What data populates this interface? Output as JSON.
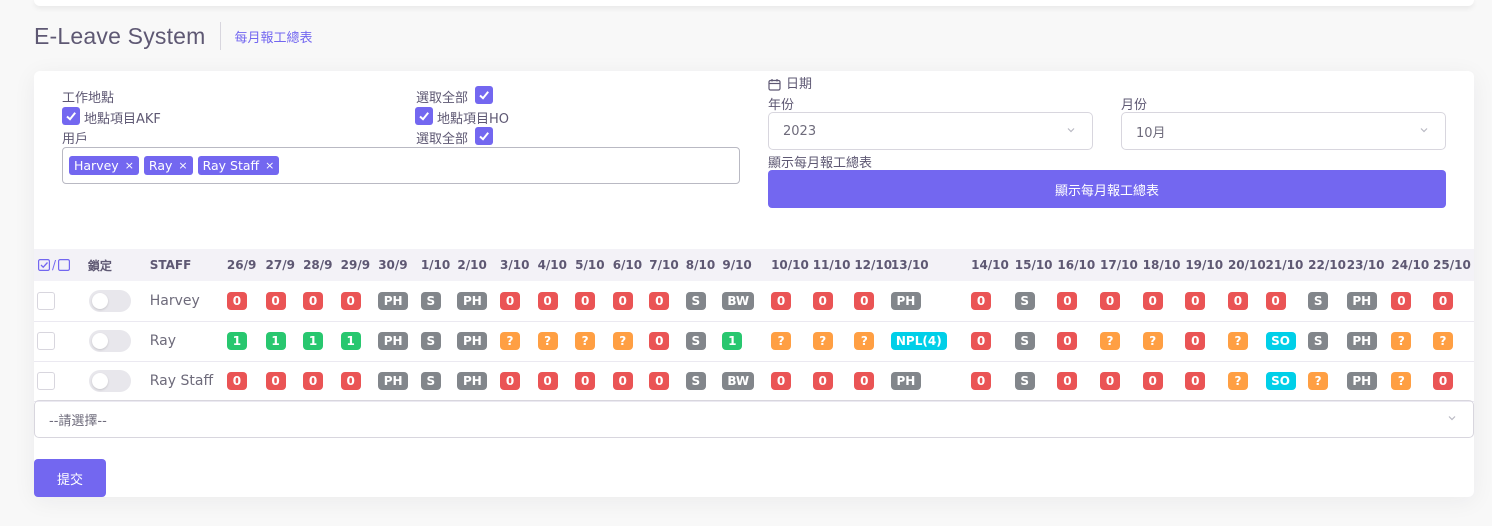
{
  "app": {
    "title": "E-Leave System",
    "breadcrumb": "每月報工總表"
  },
  "filters": {
    "location_label": "工作地點",
    "select_all_label": "選取全部",
    "locations": [
      "地點項目AKF",
      "地點項目HO"
    ],
    "user_label": "用戶",
    "users_select_all_label": "選取全部",
    "selected_users": [
      "Harvey",
      "Ray",
      "Ray Staff"
    ],
    "tag_remove": "×"
  },
  "date": {
    "label": "日期",
    "year_label": "年份",
    "year_value": "2023",
    "month_label": "月份",
    "month_value": "10月",
    "show_label": "顯示每月報工總表",
    "show_button": "顯示每月報工總表"
  },
  "table": {
    "select_header": "/",
    "lock_header": "鎖定",
    "staff_header": "STAFF",
    "dates": [
      "26/9",
      "27/9",
      "28/9",
      "29/9",
      "30/9",
      "1/10",
      "2/10",
      "3/10",
      "4/10",
      "5/10",
      "6/10",
      "7/10",
      "8/10",
      "9/10",
      "10/10",
      "11/10",
      "12/10",
      "13/10",
      "14/10",
      "15/10",
      "16/10",
      "17/10",
      "18/10",
      "19/10",
      "20/10",
      "21/10",
      "22/10",
      "23/10",
      "24/10",
      "25/10"
    ],
    "rows": [
      {
        "name": "Harvey",
        "cells": [
          {
            "t": "0",
            "c": "red"
          },
          {
            "t": "0",
            "c": "red"
          },
          {
            "t": "0",
            "c": "red"
          },
          {
            "t": "0",
            "c": "red"
          },
          {
            "t": "PH",
            "c": "gray"
          },
          {
            "t": "S",
            "c": "gray"
          },
          {
            "t": "PH",
            "c": "gray"
          },
          {
            "t": "0",
            "c": "red"
          },
          {
            "t": "0",
            "c": "red"
          },
          {
            "t": "0",
            "c": "red"
          },
          {
            "t": "0",
            "c": "red"
          },
          {
            "t": "0",
            "c": "red"
          },
          {
            "t": "S",
            "c": "gray"
          },
          {
            "t": "BW",
            "c": "gray"
          },
          {
            "t": "0",
            "c": "red"
          },
          {
            "t": "0",
            "c": "red"
          },
          {
            "t": "0",
            "c": "red"
          },
          {
            "t": "PH",
            "c": "gray"
          },
          {
            "t": "0",
            "c": "red"
          },
          {
            "t": "S",
            "c": "gray"
          },
          {
            "t": "0",
            "c": "red"
          },
          {
            "t": "0",
            "c": "red"
          },
          {
            "t": "0",
            "c": "red"
          },
          {
            "t": "0",
            "c": "red"
          },
          {
            "t": "0",
            "c": "red"
          },
          {
            "t": "0",
            "c": "red"
          },
          {
            "t": "S",
            "c": "gray"
          },
          {
            "t": "PH",
            "c": "gray"
          },
          {
            "t": "0",
            "c": "red"
          },
          {
            "t": "0",
            "c": "red"
          }
        ]
      },
      {
        "name": "Ray",
        "cells": [
          {
            "t": "1",
            "c": "green"
          },
          {
            "t": "1",
            "c": "green"
          },
          {
            "t": "1",
            "c": "green"
          },
          {
            "t": "1",
            "c": "green"
          },
          {
            "t": "PH",
            "c": "gray"
          },
          {
            "t": "S",
            "c": "gray"
          },
          {
            "t": "PH",
            "c": "gray"
          },
          {
            "t": "?",
            "c": "orange"
          },
          {
            "t": "?",
            "c": "orange"
          },
          {
            "t": "?",
            "c": "orange"
          },
          {
            "t": "?",
            "c": "orange"
          },
          {
            "t": "0",
            "c": "red"
          },
          {
            "t": "S",
            "c": "gray"
          },
          {
            "t": "1",
            "c": "green"
          },
          {
            "t": "?",
            "c": "orange"
          },
          {
            "t": "?",
            "c": "orange"
          },
          {
            "t": "?",
            "c": "orange"
          },
          {
            "t": "NPL(4)",
            "c": "cyan"
          },
          {
            "t": "0",
            "c": "red"
          },
          {
            "t": "S",
            "c": "gray"
          },
          {
            "t": "0",
            "c": "red"
          },
          {
            "t": "?",
            "c": "orange"
          },
          {
            "t": "?",
            "c": "orange"
          },
          {
            "t": "0",
            "c": "red"
          },
          {
            "t": "?",
            "c": "orange"
          },
          {
            "t": "SO",
            "c": "cyan"
          },
          {
            "t": "S",
            "c": "gray"
          },
          {
            "t": "PH",
            "c": "gray"
          },
          {
            "t": "?",
            "c": "orange"
          },
          {
            "t": "?",
            "c": "orange"
          }
        ]
      },
      {
        "name": "Ray Staff",
        "cells": [
          {
            "t": "0",
            "c": "red"
          },
          {
            "t": "0",
            "c": "red"
          },
          {
            "t": "0",
            "c": "red"
          },
          {
            "t": "0",
            "c": "red"
          },
          {
            "t": "PH",
            "c": "gray"
          },
          {
            "t": "S",
            "c": "gray"
          },
          {
            "t": "PH",
            "c": "gray"
          },
          {
            "t": "0",
            "c": "red"
          },
          {
            "t": "0",
            "c": "red"
          },
          {
            "t": "0",
            "c": "red"
          },
          {
            "t": "0",
            "c": "red"
          },
          {
            "t": "0",
            "c": "red"
          },
          {
            "t": "S",
            "c": "gray"
          },
          {
            "t": "BW",
            "c": "gray"
          },
          {
            "t": "0",
            "c": "red"
          },
          {
            "t": "0",
            "c": "red"
          },
          {
            "t": "0",
            "c": "red"
          },
          {
            "t": "PH",
            "c": "gray"
          },
          {
            "t": "0",
            "c": "red"
          },
          {
            "t": "S",
            "c": "gray"
          },
          {
            "t": "0",
            "c": "red"
          },
          {
            "t": "0",
            "c": "red"
          },
          {
            "t": "0",
            "c": "red"
          },
          {
            "t": "0",
            "c": "red"
          },
          {
            "t": "?",
            "c": "orange"
          },
          {
            "t": "SO",
            "c": "cyan"
          },
          {
            "t": "?",
            "c": "orange"
          },
          {
            "t": "PH",
            "c": "gray"
          },
          {
            "t": "?",
            "c": "orange"
          },
          {
            "t": "0",
            "c": "red"
          }
        ]
      }
    ]
  },
  "action_select": {
    "placeholder": "--請選擇--"
  },
  "submit_label": "提交",
  "colors": {
    "accent": "#7367f0",
    "red": "#ea5455",
    "gray": "#82868b",
    "green": "#28c76f",
    "orange": "#ff9f43",
    "cyan": "#00cfe8"
  }
}
